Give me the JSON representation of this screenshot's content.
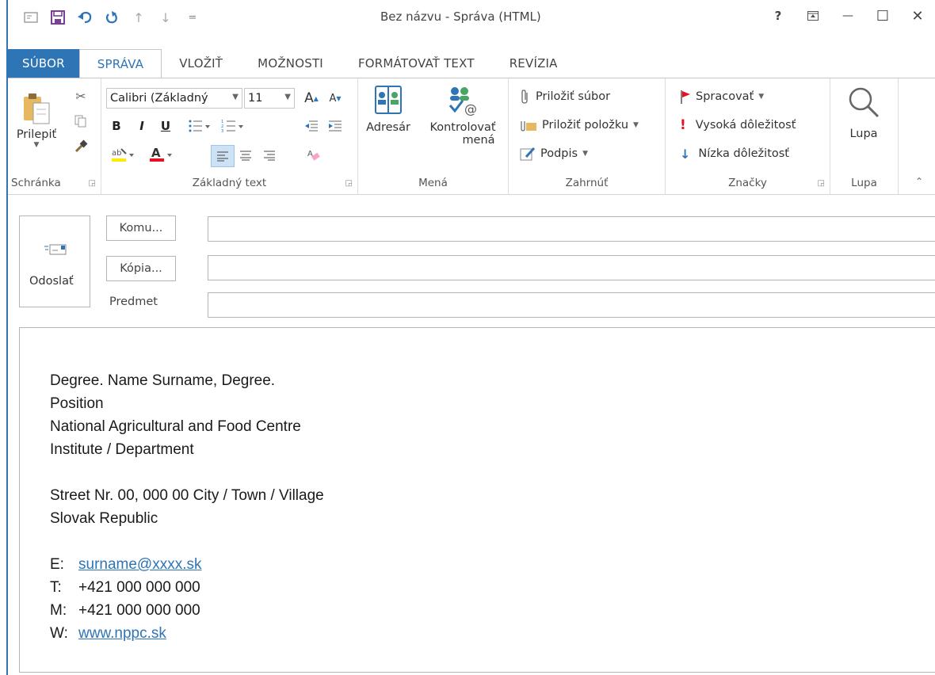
{
  "window": {
    "title": "Bez názvu - Správa (HTML)",
    "help": "?",
    "ribbon_toggle": "⊼",
    "minimize": "—",
    "maximize": "☐",
    "close": "✕"
  },
  "qat": {
    "customize": "="
  },
  "tabs": [
    "SÚBOR",
    "SPRÁVA",
    "VLOŽIŤ",
    "MOŽNOSTI",
    "FORMÁTOVAŤ TEXT",
    "REVÍZIA"
  ],
  "ribbon": {
    "clipboard": {
      "paste_label": "Prilepiť",
      "group_label": "Schránka"
    },
    "basic_text": {
      "font_name": "Calibri (Základný",
      "font_size": "11",
      "bold": "B",
      "italic": "I",
      "underline": "U",
      "grow": "A",
      "shrink": "A",
      "group_label": "Základný text"
    },
    "names": {
      "address_book": "Adresár",
      "check_names_1": "Kontrolovať",
      "check_names_2": "mená",
      "group_label": "Mená"
    },
    "include": {
      "attach_file": "Priložiť súbor",
      "attach_item": "Priložiť položku",
      "signature": "Podpis",
      "group_label": "Zahrnúť"
    },
    "tags": {
      "follow_up": "Spracovať",
      "high_importance": "Vysoká dôležitosť",
      "low_importance": "Nízka dôležitosť",
      "group_label": "Značky"
    },
    "zoom": {
      "zoom_label": "Lupa",
      "group_label": "Lupa"
    }
  },
  "header": {
    "send_label": "Odoslať",
    "to_button": "Komu...",
    "cc_button": "Kópia...",
    "subject_label": "Predmet",
    "to_value": "",
    "cc_value": "",
    "subject_value": ""
  },
  "body": {
    "line1": "Degree. Name Surname, Degree.",
    "line2": "Position",
    "line3": "National Agricultural and Food Centre",
    "line4": "Institute / Department",
    "line5": "Street Nr. 00, 000 00 City / Town / Village",
    "line6": "Slovak Republic",
    "email_label": "E:",
    "email": "surname@xxxx.sk",
    "phone_label": "T:",
    "phone": "+421 000 000 000",
    "mobile_label": "M:",
    "mobile": "+421 000 000 000",
    "web_label": "W:",
    "web": "www.nppc.sk"
  },
  "colors": {
    "accent": "#2e75b6",
    "high_importance": "#e81123",
    "flag": "#e81123"
  }
}
